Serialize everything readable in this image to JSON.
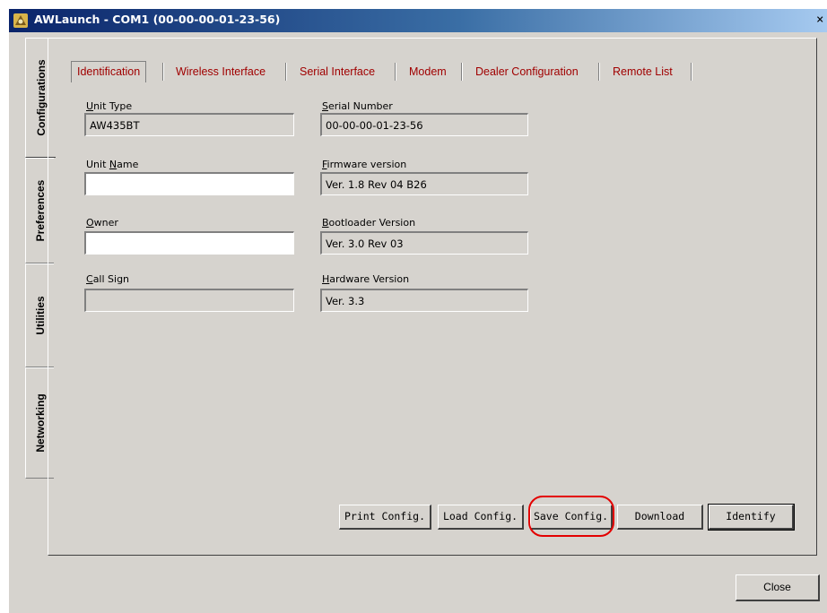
{
  "window": {
    "title": "AWLaunch - COM1  (00-00-00-01-23-56)",
    "close_glyph": "×",
    "icon": "app-icon"
  },
  "vertical_tabs": [
    {
      "label": "Configurations",
      "active": true
    },
    {
      "label": "Preferences",
      "active": false
    },
    {
      "label": "Utilities",
      "active": false
    },
    {
      "label": "Networking",
      "active": false
    }
  ],
  "tabs": [
    {
      "label": "Identification",
      "active": true
    },
    {
      "label": "Wireless Interface",
      "active": false
    },
    {
      "label": "Serial Interface",
      "active": false
    },
    {
      "label": "Modem",
      "active": false
    },
    {
      "label": "Dealer Configuration",
      "active": false
    },
    {
      "label": "Remote List",
      "active": false
    }
  ],
  "fields": {
    "unit_type": {
      "label_first": "U",
      "label_rest": "nit Type",
      "value": "AW435BT"
    },
    "unit_name": {
      "label_first": "Unit ",
      "label_u": "N",
      "label_rest": "ame",
      "value": ""
    },
    "owner": {
      "label_u": "O",
      "label_rest": "wner",
      "value": ""
    },
    "call_sign": {
      "label_u": "C",
      "label_rest": "all Sign",
      "value": ""
    },
    "serial_number": {
      "label_u": "S",
      "label_rest": "erial Number",
      "value": "00-00-00-01-23-56"
    },
    "firmware_version": {
      "label_u": "F",
      "label_rest": "irmware version",
      "value": "Ver. 1.8 Rev 04 B26"
    },
    "bootloader_version": {
      "label_u": "B",
      "label_rest": "ootloader Version",
      "value": "Ver. 3.0 Rev 03"
    },
    "hardware_version": {
      "label_u": "H",
      "label_rest": "ardware Version",
      "value": "Ver. 3.3"
    }
  },
  "buttons": {
    "print_config": "Print Config.",
    "load_config": "Load Config.",
    "save_config": "Save Config.",
    "download": "Download",
    "identify": "Identify",
    "close": "Close"
  },
  "colors": {
    "tab_text": "#a00000",
    "highlight": "#e30000",
    "titlebar": "#0a246a"
  }
}
